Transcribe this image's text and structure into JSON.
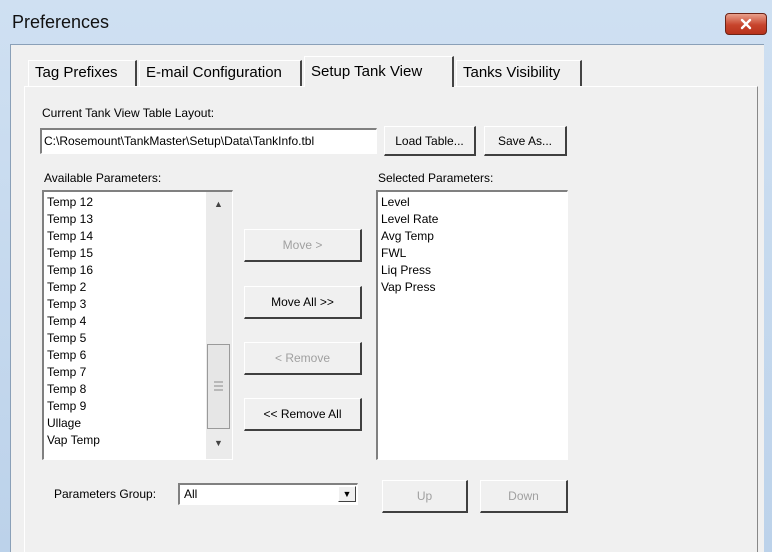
{
  "window": {
    "title": "Preferences"
  },
  "tabs": [
    "Tag Prefixes",
    "E-mail Configuration",
    "Setup Tank View",
    "Tanks Visibility"
  ],
  "layout_section": {
    "label": "Current Tank View Table Layout:",
    "path": "C:\\Rosemount\\TankMaster\\Setup\\Data\\TankInfo.tbl",
    "load_button": "Load Table...",
    "save_button": "Save As..."
  },
  "available": {
    "label": "Available Parameters:",
    "items": [
      "Temp 12",
      "Temp 13",
      "Temp 14",
      "Temp 15",
      "Temp 16",
      "Temp 2",
      "Temp 3",
      "Temp 4",
      "Temp 5",
      "Temp 6",
      "Temp 7",
      "Temp 8",
      "Temp 9",
      "Ullage",
      "Vap Temp"
    ]
  },
  "selected": {
    "label": "Selected Parameters:",
    "items": [
      "Level",
      "Level Rate",
      "Avg Temp",
      "FWL",
      "Liq Press",
      "Vap Press"
    ]
  },
  "move_buttons": {
    "move": "Move >",
    "move_all": "Move All >>",
    "remove": "< Remove",
    "remove_all": "<< Remove All"
  },
  "group": {
    "label": "Parameters Group:",
    "value": "All"
  },
  "order_buttons": {
    "up": "Up",
    "down": "Down"
  },
  "colors": {
    "close_button": "#c7442c",
    "disabled_text": "#a0a0a0",
    "window_frame": "#c9dcef"
  }
}
